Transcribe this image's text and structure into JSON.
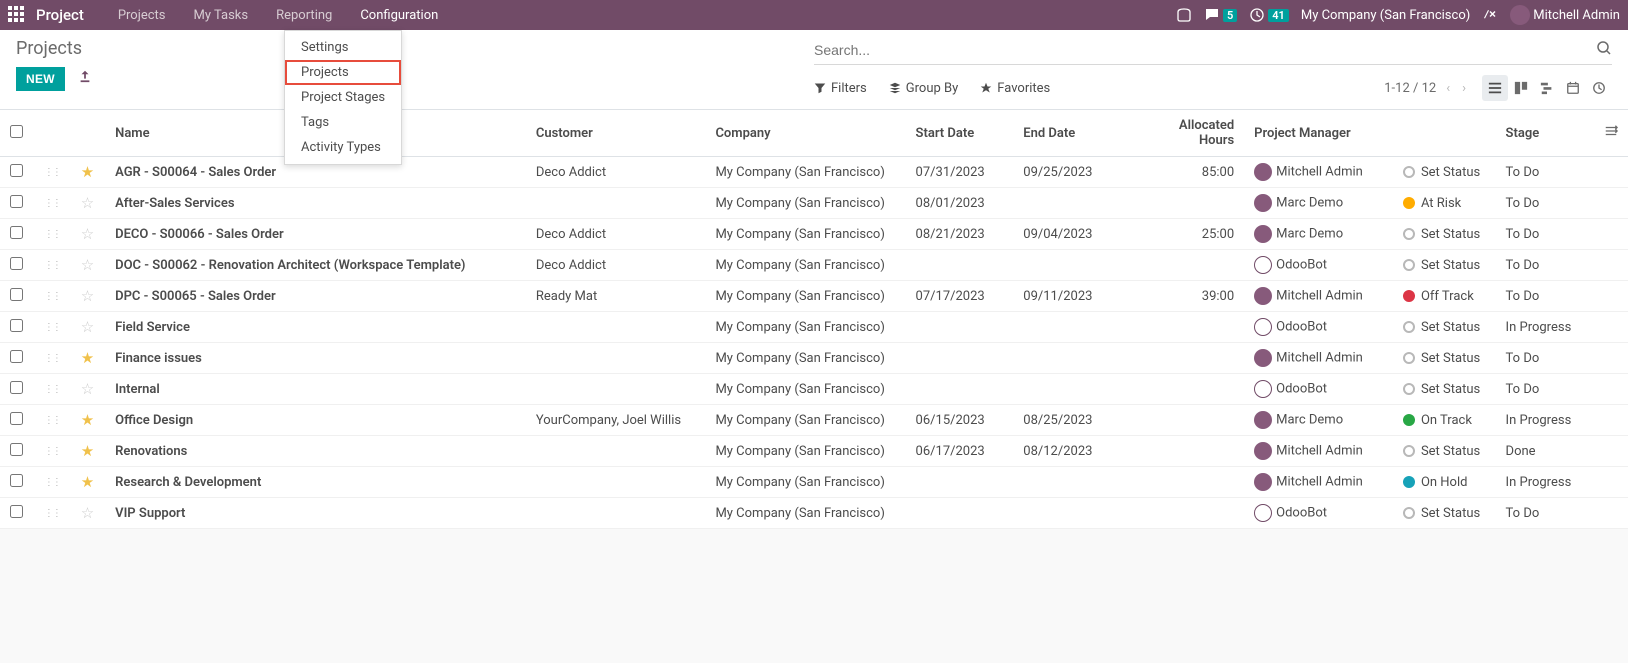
{
  "navbar": {
    "app_name": "Project",
    "menu": [
      "Projects",
      "My Tasks",
      "Reporting",
      "Configuration"
    ],
    "active_menu": 3,
    "chat_badge": "5",
    "activity_badge": "41",
    "company": "My Company (San Francisco)",
    "user": "Mitchell Admin"
  },
  "dropdown": {
    "items": [
      "Settings",
      "Projects",
      "Project Stages",
      "Tags",
      "Activity Types"
    ],
    "highlighted": 1
  },
  "control": {
    "breadcrumb": "Projects",
    "new_btn": "NEW",
    "search_placeholder": "Search...",
    "filters": "Filters",
    "groupby": "Group By",
    "favorites": "Favorites",
    "pager": "1-12 / 12"
  },
  "columns": {
    "name": "Name",
    "customer": "Customer",
    "company": "Company",
    "start": "Start Date",
    "end": "End Date",
    "hours": "Allocated Hours",
    "pm": "Project Manager",
    "stage": "Stage"
  },
  "status_labels": {
    "set": "Set Status",
    "on_track": "On Track",
    "at_risk": "At Risk",
    "off_track": "Off Track",
    "on_hold": "On Hold"
  },
  "rows": [
    {
      "star": true,
      "name": "AGR - S00064 - Sales Order",
      "customer": "Deco Addict",
      "company": "My Company (San Francisco)",
      "start": "07/31/2023",
      "end": "09/25/2023",
      "hours": "85:00",
      "pm": "Mitchell Admin",
      "pm_type": "user",
      "status": "set",
      "stage": "To Do"
    },
    {
      "star": false,
      "name": "After-Sales Services",
      "customer": "",
      "company": "My Company (San Francisco)",
      "start": "08/01/2023",
      "end": "",
      "hours": "",
      "pm": "Marc Demo",
      "pm_type": "user",
      "status": "at_risk",
      "stage": "To Do"
    },
    {
      "star": false,
      "name": "DECO - S00066 - Sales Order",
      "customer": "Deco Addict",
      "company": "My Company (San Francisco)",
      "start": "08/21/2023",
      "end": "09/04/2023",
      "hours": "25:00",
      "pm": "Marc Demo",
      "pm_type": "user",
      "status": "set",
      "stage": "To Do"
    },
    {
      "star": false,
      "name": "DOC - S00062 - Renovation Architect (Workspace Template)",
      "customer": "Deco Addict",
      "company": "My Company (San Francisco)",
      "start": "",
      "end": "",
      "hours": "",
      "pm": "OdooBot",
      "pm_type": "bot",
      "status": "set",
      "stage": "To Do"
    },
    {
      "star": false,
      "name": "DPC - S00065 - Sales Order",
      "customer": "Ready Mat",
      "company": "My Company (San Francisco)",
      "start": "07/17/2023",
      "end": "09/11/2023",
      "hours": "39:00",
      "pm": "Mitchell Admin",
      "pm_type": "user",
      "status": "off_track",
      "stage": "To Do"
    },
    {
      "star": false,
      "name": "Field Service",
      "customer": "",
      "company": "My Company (San Francisco)",
      "start": "",
      "end": "",
      "hours": "",
      "pm": "OdooBot",
      "pm_type": "bot",
      "status": "set",
      "stage": "In Progress"
    },
    {
      "star": true,
      "name": "Finance issues",
      "customer": "",
      "company": "My Company (San Francisco)",
      "start": "",
      "end": "",
      "hours": "",
      "pm": "Mitchell Admin",
      "pm_type": "user",
      "status": "set",
      "stage": "To Do"
    },
    {
      "star": false,
      "name": "Internal",
      "customer": "",
      "company": "My Company (San Francisco)",
      "start": "",
      "end": "",
      "hours": "",
      "pm": "OdooBot",
      "pm_type": "bot",
      "status": "set",
      "stage": "To Do"
    },
    {
      "star": true,
      "name": "Office Design",
      "customer": "YourCompany, Joel Willis",
      "company": "My Company (San Francisco)",
      "start": "06/15/2023",
      "end": "08/25/2023",
      "hours": "",
      "pm": "Marc Demo",
      "pm_type": "user",
      "status": "on_track",
      "stage": "In Progress"
    },
    {
      "star": true,
      "name": "Renovations",
      "customer": "",
      "company": "My Company (San Francisco)",
      "start": "06/17/2023",
      "end": "08/12/2023",
      "hours": "",
      "pm": "Mitchell Admin",
      "pm_type": "user",
      "status": "set",
      "stage": "Done"
    },
    {
      "star": true,
      "name": "Research & Development",
      "customer": "",
      "company": "My Company (San Francisco)",
      "start": "",
      "end": "",
      "hours": "",
      "pm": "Mitchell Admin",
      "pm_type": "user",
      "status": "on_hold",
      "stage": "In Progress"
    },
    {
      "star": false,
      "name": "VIP Support",
      "customer": "",
      "company": "My Company (San Francisco)",
      "start": "",
      "end": "",
      "hours": "",
      "pm": "OdooBot",
      "pm_type": "bot",
      "status": "set",
      "stage": "To Do"
    }
  ]
}
